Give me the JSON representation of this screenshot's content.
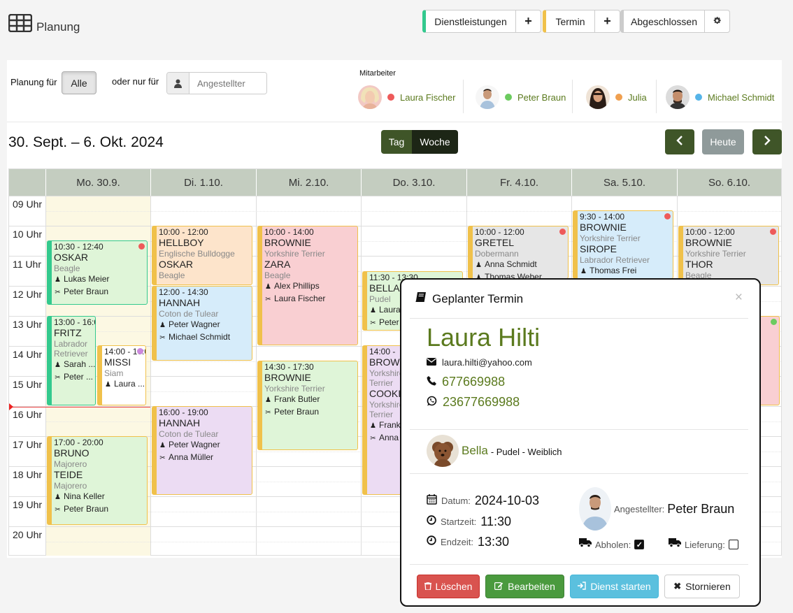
{
  "header": {
    "title": "Planung",
    "dienstleistungen_label": "Dienstleistungen",
    "termin_label": "Termin",
    "abgeschlossen_label": "Abgeschlossen",
    "plus": "+",
    "colors": {
      "dienstleistungen": "#33c98e",
      "termin": "#f0c14b",
      "abgeschlossen": "#cccccc"
    }
  },
  "filter": {
    "planung_fuer_label": "Planung für",
    "alle_label": "Alle",
    "oder_nur_fuer_label": "oder nur für",
    "employee_placeholder": "Angestellter",
    "mitarbeiter_label": "Mitarbeiter",
    "staff": [
      {
        "name": "Laura Fischer",
        "color": "#ee5a5a"
      },
      {
        "name": "Peter Braun",
        "color": "#6ccb5f"
      },
      {
        "name": "Julia",
        "color": "#f0a050"
      },
      {
        "name": "Michael Schmidt",
        "color": "#56b4e8"
      }
    ]
  },
  "calendar": {
    "range_title": "30. Sept. – 6. Okt. 2024",
    "view_tag": "Tag",
    "view_woche": "Woche",
    "heute_label": "Heute",
    "prev_icon": "chevron-left-icon",
    "next_icon": "chevron-right-icon",
    "days": [
      "Mo. 30.9.",
      "Di. 1.10.",
      "Mi. 2.10.",
      "Do. 3.10.",
      "Fr. 4.10.",
      "Sa. 5.10.",
      "So. 6.10."
    ],
    "hours": [
      "09 Uhr",
      "10 Uhr",
      "11 Uhr",
      "12 Uhr",
      "13 Uhr",
      "14 Uhr",
      "15 Uhr",
      "16 Uhr",
      "17 Uhr",
      "18 Uhr",
      "19 Uhr",
      "20 Uhr"
    ],
    "events": [
      {
        "time": "10:30 - 12:40",
        "lines": [
          [
            "OSKAR",
            "Beagle"
          ]
        ],
        "owner": "Lukas Meier",
        "staff": "Peter Braun",
        "border": "#33c98e",
        "bg": "#dff5d8",
        "status": "#ee5a5a"
      },
      {
        "time": "13:00 - 16:0",
        "lines": [
          [
            "FRITZ",
            "Labrador Retriever"
          ]
        ],
        "owner": "Sarah ...",
        "staff": "Peter ...",
        "border": "#33c98e",
        "bg": "#dff5d8",
        "status": ""
      },
      {
        "time": "14:00 - 16:0",
        "lines": [
          [
            "MISSI",
            "Siam"
          ]
        ],
        "owner": "Laura ...",
        "staff": "",
        "border": "#f0c14b",
        "bg": "#ffffff",
        "status": "#cc88dd"
      },
      {
        "time": "17:00 - 20:00",
        "lines": [
          [
            "BRUNO",
            "Majorero"
          ],
          [
            "TEIDE",
            "Majorero"
          ]
        ],
        "owner": "Nina Keller",
        "staff": "Peter Braun",
        "border": "#f0c14b",
        "bg": "#dff5d8",
        "status": ""
      },
      {
        "time": "10:00 - 12:00",
        "lines": [
          [
            "HELLBOY",
            "Englische Bulldogge"
          ],
          [
            "OSKAR",
            "Beagle"
          ]
        ],
        "owner": "",
        "staff": "",
        "border": "#f0c14b",
        "bg": "#fde4cb",
        "status": ""
      },
      {
        "time": "12:00 - 14:30",
        "lines": [
          [
            "HANNAH",
            "Coton de Tulear"
          ]
        ],
        "owner": "Peter Wagner",
        "staff": "Michael Schmidt",
        "border": "#f0c14b",
        "bg": "#d6ecfa",
        "status": ""
      },
      {
        "time": "16:00 - 19:00",
        "lines": [
          [
            "HANNAH",
            "Coton de Tulear"
          ]
        ],
        "owner": "Peter Wagner",
        "staff": "Anna Müller",
        "border": "#f0c14b",
        "bg": "#ecdcf3",
        "status": ""
      },
      {
        "time": "10:00 - 14:00",
        "lines": [
          [
            "BROWNIE",
            "Yorkshire Terrier"
          ],
          [
            "ZARA",
            "Beagle"
          ]
        ],
        "owner": "Alex Phillips",
        "staff": "Laura Fischer",
        "border": "#f0c14b",
        "bg": "#f9cfd2",
        "status": ""
      },
      {
        "time": "14:30 - 17:30",
        "lines": [
          [
            "BROWNIE",
            "Yorkshire Terrier"
          ]
        ],
        "owner": "Frank Butler",
        "staff": "Peter Braun",
        "border": "#f0c14b",
        "bg": "#dff5d8",
        "status": ""
      },
      {
        "time": "11:30 - 13:30",
        "lines": [
          [
            "BELLA",
            "Pudel"
          ]
        ],
        "owner": "Laura",
        "staff": "Peter",
        "border": "#f0c14b",
        "bg": "#dff5d8",
        "status": ""
      },
      {
        "time": "14:00 -",
        "lines": [
          [
            "BROWN",
            "Yorkshire Terrier"
          ],
          [
            "COOKI",
            "Yorkshire Terrier"
          ]
        ],
        "owner": "Frank",
        "staff": "Anna",
        "border": "#f0c14b",
        "bg": "#ecdcf3",
        "status": ""
      },
      {
        "time": "10:00 - 12:00",
        "lines": [
          [
            "GRETEL",
            "Dobermann"
          ]
        ],
        "owner": "Anna Schmidt",
        "staff": "",
        "extra": "Thomas Weber",
        "border": "#f0c14b",
        "bg": "#e6e6e6",
        "status": "#ee5a5a"
      },
      {
        "time": "9:30 - 14:00",
        "lines": [
          [
            "BROWNIE",
            "Yorkshire Terrier"
          ],
          [
            "SIROPE",
            "Labrador Retriever"
          ]
        ],
        "owner": "Thomas Frei",
        "staff": "",
        "border": "#f0c14b",
        "bg": "#d6ecfa",
        "status": "#ee5a5a"
      },
      {
        "time": "10:00 - 12:00",
        "lines": [
          [
            "BROWNIE",
            "Yorkshire Terrier"
          ],
          [
            "THOR",
            "Beagle"
          ]
        ],
        "owner": "",
        "staff": "",
        "border": "#f0c14b",
        "bg": "#e6e6e6",
        "status": "#ee5a5a"
      },
      {
        "time": "",
        "lines": [],
        "owner": "",
        "staff": "",
        "border": "#f0c14b",
        "bg": "#f9cfd2",
        "status": "#6ccb5f"
      }
    ]
  },
  "modal": {
    "title": "Geplanter Termin",
    "close": "×",
    "customer_name": "Laura Hilti",
    "email": "laura.hilti@yahoo.com",
    "phone": "677669988",
    "whatsapp": "23677669988",
    "pet_name": "Bella",
    "pet_details": "- Pudel - Weiblich",
    "datum_label": "Datum:",
    "datum_value": "2024-10-03",
    "startzeit_label": "Startzeit:",
    "startzeit_value": "11:30",
    "endzeit_label": "Endzeit:",
    "endzeit_value": "13:30",
    "angestellter_label": "Angestellter:",
    "angestellter_value": "Peter Braun",
    "abholen_label": "Abholen:",
    "abholen_checked": true,
    "lieferung_label": "Lieferung:",
    "lieferung_checked": false,
    "btn_loeschen": "Löschen",
    "btn_bearbeiten": "Bearbeiten",
    "btn_dienst_starten": "Dienst starten",
    "btn_stornieren": "Stornieren"
  }
}
